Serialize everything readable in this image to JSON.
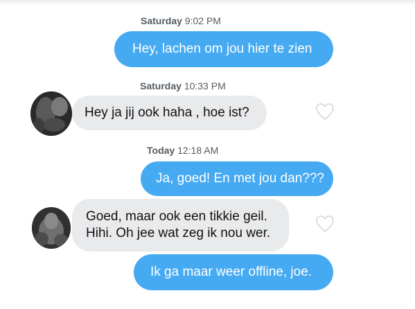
{
  "conversation": {
    "timestamps": [
      {
        "day": "Saturday",
        "time": "9:02 PM"
      },
      {
        "day": "Saturday",
        "time": "10:33 PM"
      },
      {
        "day": "Today",
        "time": "12:18 AM"
      }
    ],
    "messages": [
      {
        "direction": "outgoing",
        "lines": [
          "Hey, lachen om jou hier te zien"
        ]
      },
      {
        "direction": "incoming",
        "lines": [
          "Hey ja jij ook haha , hoe ist?"
        ]
      },
      {
        "direction": "outgoing",
        "lines": [
          "Ja, goed! En met jou dan???"
        ]
      },
      {
        "direction": "incoming",
        "lines": [
          "Goed, maar ook een tikkie geil.",
          "Hihi. Oh jee wat zeg ik nou wer."
        ]
      },
      {
        "direction": "outgoing",
        "lines": [
          "Ik ga maar weer offline, joe."
        ]
      }
    ]
  },
  "icons": {
    "like": "heart-outline-icon",
    "avatar": "contact-avatar"
  },
  "colors": {
    "outgoing_bubble": "#45aaf2",
    "incoming_bubble": "#e9eaec",
    "outgoing_text": "#ffffff",
    "incoming_text": "#111111",
    "timestamp_text": "#555b61",
    "heart_outline": "#d8dade"
  }
}
